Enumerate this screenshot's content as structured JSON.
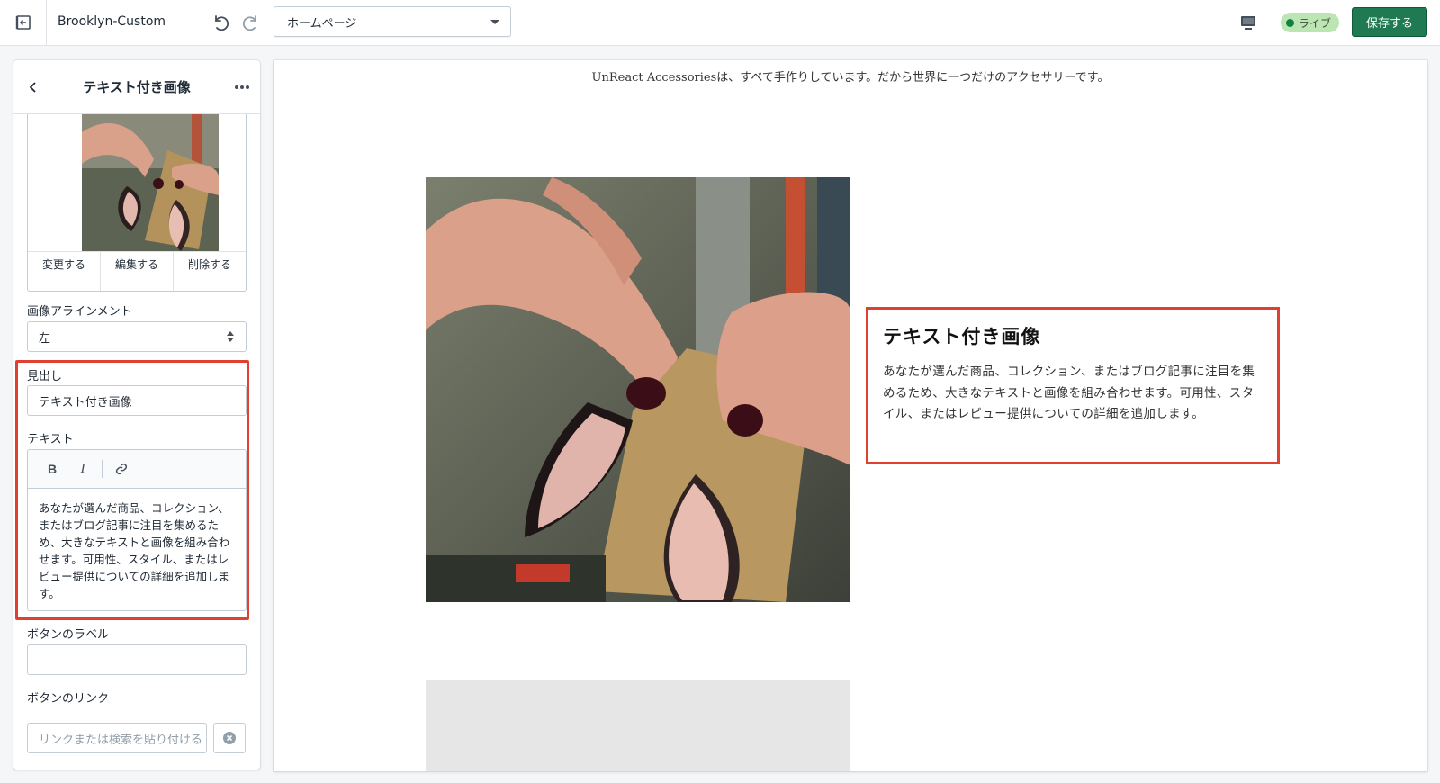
{
  "topbar": {
    "theme_name": "Brooklyn-Custom",
    "page_select_value": "ホームページ",
    "live_label": "ライブ",
    "save_label": "保存する"
  },
  "sidebar": {
    "title": "テキスト付き画像",
    "image_actions": [
      "変更する",
      "編集する",
      "削除する"
    ],
    "alignment_label": "画像アラインメント",
    "alignment_value": "左",
    "heading_label": "見出し",
    "heading_value": "テキスト付き画像",
    "text_label": "テキスト",
    "text_value": "あなたが選んだ商品、コレクション、またはブログ記事に注目を集めるため、大きなテキストと画像を組み合わせます。可用性、スタイル、またはレビュー提供についての詳細を追加します。",
    "button_label_label": "ボタンのラベル",
    "button_label_value": "",
    "button_link_label": "ボタンのリンク",
    "button_link_placeholder": "リンクまたは検索を貼り付ける"
  },
  "preview": {
    "announcement": "UnReact Accessoriesは、すべて手作りしています。だから世界に一つだけのアクセサリーです。",
    "section_heading": "テキスト付き画像",
    "section_text": "あなたが選んだ商品、コレクション、またはブログ記事に注目を集めるため、大きなテキストと画像を組み合わせます。可用性、スタイル、またはレビュー提供についての詳細を追加します。"
  },
  "colors": {
    "accent": "#1f7a52",
    "live_badge": "#bbe5b3",
    "highlight": "#e0402f"
  },
  "icons": [
    "exit-icon",
    "undo-icon",
    "redo-icon",
    "chevron-down-icon",
    "desktop-icon",
    "back-icon",
    "more-icon",
    "bold-icon",
    "italic-icon",
    "link-icon",
    "clear-icon",
    "select-arrows-icon"
  ]
}
